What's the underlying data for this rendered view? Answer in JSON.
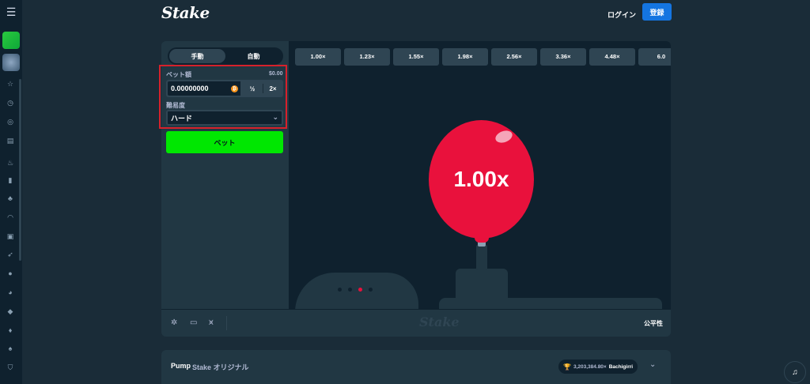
{
  "header": {
    "logo": "Stake",
    "login_label": "ログイン",
    "register_label": "登録"
  },
  "sidebar": {
    "menu_icon": "menu-icon",
    "icons": [
      "star-icon",
      "history-icon",
      "casino-chip-icon",
      "list-icon",
      "fire-icon",
      "bookmark-icon",
      "spades-icon",
      "headset-icon",
      "gift-icon",
      "rocket-icon",
      "globe-icon",
      "basketball-icon",
      "football-icon",
      "flame-icon",
      "slots-icon",
      "shield-icon"
    ]
  },
  "panel": {
    "mode_manual": "手動",
    "mode_auto": "自動",
    "bet_amount_label": "ベット額",
    "bet_amount_usd": "$0.00",
    "bet_amount_value": "0.00000000",
    "coin_symbol": "₿",
    "half_label": "½",
    "double_label": "2×",
    "difficulty_label": "難易度",
    "difficulty_value": "ハード",
    "bet_button_label": "ベット"
  },
  "stage": {
    "multipliers": [
      "1.00×",
      "1.23×",
      "1.55×",
      "1.98×",
      "2.56×",
      "3.36×",
      "4.48×",
      "6.0"
    ],
    "balloon_text": "1.00x",
    "active_dot": 2
  },
  "game_footer": {
    "logo": "Stake",
    "fairness_label": "公平性"
  },
  "info_bar": {
    "title": "Pump",
    "subtitle": "Stake オリジナル",
    "record_value": "3,203,384.80×",
    "record_user": "Bachigirri"
  },
  "colors": {
    "background": "#1a2c38",
    "sidebar": "#0f212e",
    "panel": "#213743",
    "accent_green": "#00e701",
    "accent_blue": "#1475e1",
    "balloon_red": "#e9113c",
    "highlight": "#d6212b"
  }
}
